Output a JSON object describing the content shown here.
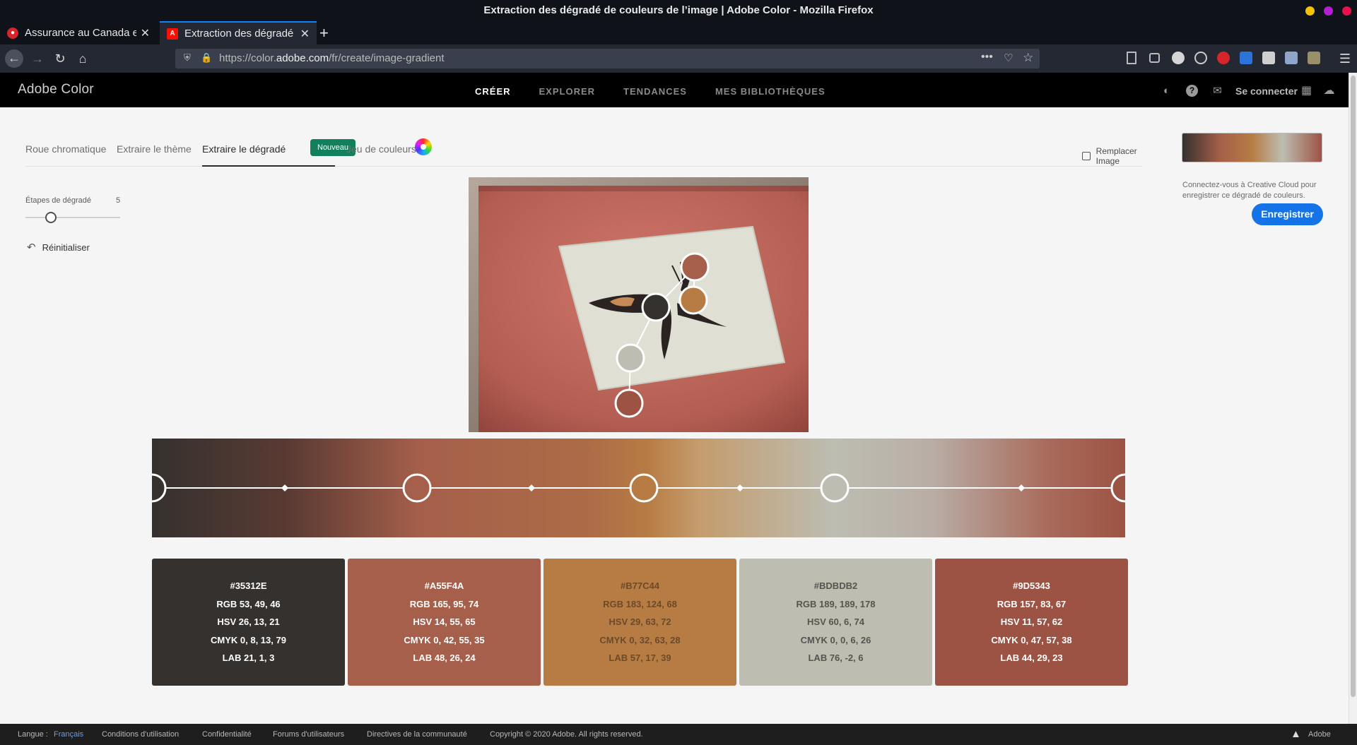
{
  "window": {
    "title": "Extraction des dégradé de couleurs de l’image | Adobe Color - Mozilla Firefox"
  },
  "tabs": [
    {
      "label": "Assurance au Canada en ligne",
      "close": "✕"
    },
    {
      "label": "Extraction des dégradé de couleurs",
      "close": "✕"
    }
  ],
  "newtab": "+",
  "url": {
    "prefix": "https://color.",
    "host": "adobe.com",
    "path": "/fr/create/image-gradient"
  },
  "app": {
    "brand": "Adobe Color",
    "nav": [
      "CRÉER",
      "EXPLORER",
      "TENDANCES",
      "MES BIBLIOTHÈQUES"
    ],
    "signin": "Se connecter"
  },
  "subtabs": {
    "wheel": "Roue chromatique",
    "theme": "Extraire le thème",
    "gradient": "Extraire le dégradé",
    "badge": "Nouveau",
    "sets": "Jeu de couleurs",
    "replace": "Remplacer Image"
  },
  "controls": {
    "steps_label": "Étapes de dégradé",
    "steps_value": "5",
    "reset": "Réinitialiser"
  },
  "swatches": [
    {
      "hex": "#35312E",
      "rgb": "RGB 53, 49, 46",
      "hsv": "HSV 26, 13, 21",
      "cmyk": "CMYK 0, 8, 13, 79",
      "lab": "LAB 21, 1, 3",
      "bg": "#35312e",
      "fg": "#ffffff"
    },
    {
      "hex": "#A55F4A",
      "rgb": "RGB 165, 95, 74",
      "hsv": "HSV 14, 55, 65",
      "cmyk": "CMYK 0, 42, 55, 35",
      "lab": "LAB 48, 26, 24",
      "bg": "#a55f4a",
      "fg": "#ffffff"
    },
    {
      "hex": "#B77C44",
      "rgb": "RGB 183, 124, 68",
      "hsv": "HSV 29, 63, 72",
      "cmyk": "CMYK 0, 32, 63, 28",
      "lab": "LAB 57, 17, 39",
      "bg": "#b77c44",
      "fg": "#6b4a2a"
    },
    {
      "hex": "#BDBDB2",
      "rgb": "RGB 189, 189, 178",
      "hsv": "HSV 60, 6, 74",
      "cmyk": "CMYK 0, 0, 6, 26",
      "lab": "LAB 76, -2, 6",
      "bg": "#bdbdb2",
      "fg": "#555550"
    },
    {
      "hex": "#9D5343",
      "rgb": "RGB 157, 83, 67",
      "hsv": "HSV 11, 57, 62",
      "cmyk": "CMYK 0, 47, 57, 38",
      "lab": "LAB 44, 29, 23",
      "bg": "#9d5343",
      "fg": "#ffffff"
    }
  ],
  "right_panel": {
    "cc_text": "Connectez-vous à Creative Cloud pour enregistrer ce dégradé de couleurs.",
    "save": "Enregistrer"
  },
  "footer": {
    "lang_label": "Langue :",
    "lang": "Français",
    "links": [
      "Conditions d'utilisation",
      "Confidentialité",
      "Forums d'utilisateurs",
      "Directives de la communauté"
    ],
    "copyright": "Copyright © 2020 Adobe. All rights reserved.",
    "adobe": "Adobe"
  },
  "icons": {
    "back": "arrow-left-icon",
    "forward": "arrow-right-icon",
    "reload": "reload-icon",
    "home": "home-icon",
    "theme": "contrast-icon",
    "help": "help-icon",
    "chat": "chat-icon",
    "apps": "apps-grid-icon",
    "cc": "creative-cloud-icon"
  }
}
